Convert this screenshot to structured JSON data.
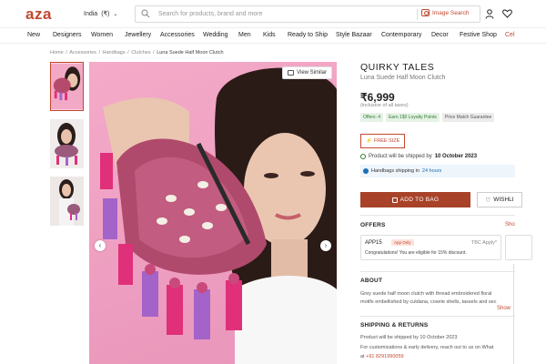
{
  "header": {
    "logo": "aza",
    "country": "India",
    "currency": "(₹)",
    "search_placeholder": "Search for products, brand and more",
    "image_search": "Image Search"
  },
  "nav": [
    "New",
    "Designers",
    "Women",
    "Jewellery",
    "Accessories",
    "Wedding",
    "Men",
    "Kids",
    "Ready to Ship",
    "Style Bazaar",
    "Contemporary",
    "Decor",
    "Festive Shop",
    "Cel"
  ],
  "breadcrumb": [
    "Home",
    "Accessories",
    "Handbags",
    "Clutches",
    "Luna Suede Half Moon Clutch"
  ],
  "gallery": {
    "view_similar": "View Similar",
    "prev": "‹",
    "next": "›"
  },
  "product": {
    "brand": "QUIRKY TALES",
    "name": "Luna Suede Half Moon Clutch",
    "price": "₹6,999",
    "taxes": "(inclusive of all taxes)",
    "tags": [
      "Offers: 4",
      "Earn 1$0 Loyalty Points",
      "Price Match Guarantee"
    ],
    "free_size": "FREE SIZE",
    "shipped_by_prefix": "Product will be shipped by",
    "shipped_by_date": "10 October 2023",
    "shipping_note_prefix": "Handbags shipping in",
    "shipping_note_hl": "24 hours",
    "add_to_bag": "ADD TO BAG",
    "wishlist": "WISHLI"
  },
  "offers": {
    "title": "OFFERS",
    "show": "Sho",
    "code": "APP15",
    "badge": "App Only",
    "tbc": "TBC Apply*",
    "message": "Congratulations! You are eligible for 15% discount."
  },
  "about": {
    "title": "ABOUT",
    "lines": [
      "Grey suede half moon clutch with thread embroidered floral",
      "motifs embellished by cutdana, cowrie shells, tassels and sec"
    ],
    "show": "Show"
  },
  "shipping": {
    "title": "SHIPPING & RETURNS",
    "line1": "Product will be shipped by 10 October 2023",
    "line2": "For customizations & early delivery, reach out to us on What",
    "line3_prefix": "at",
    "phone": "+91 8291990059"
  }
}
